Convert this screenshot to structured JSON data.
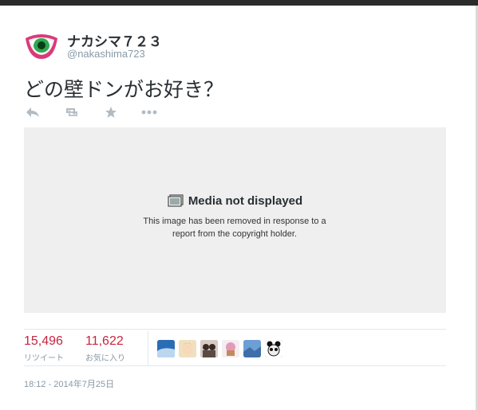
{
  "user": {
    "display_name": "ナカシマ７２３",
    "handle": "@nakashima723",
    "avatar_icon": "green-eye-mouth-avatar"
  },
  "tweet": {
    "text": "どの壁ドンがお好き？"
  },
  "actions": [
    {
      "icon": "reply-icon"
    },
    {
      "icon": "retweet-icon"
    },
    {
      "icon": "favorite-star-icon"
    },
    {
      "icon": "more-icon"
    }
  ],
  "media_notice": {
    "title": "Media not displayed",
    "line1": "This image has been removed in response to a",
    "line2": "report from the copyright holder."
  },
  "stats": {
    "retweets_count": "15,496",
    "retweets_label": "リツイート",
    "favorites_count": "11,622",
    "favorites_label": "お気に入り"
  },
  "favoriters": [
    {
      "icon": "avatar-blue-icon",
      "color": "#2a6db5"
    },
    {
      "icon": "avatar-anime-icon",
      "color": "#e2c796"
    },
    {
      "icon": "avatar-couple-icon",
      "color": "#5b4a44"
    },
    {
      "icon": "avatar-cupcake-icon",
      "color": "#e7c9d6"
    },
    {
      "icon": "avatar-sky-icon",
      "color": "#6d9fd6"
    },
    {
      "icon": "avatar-panda-icon",
      "color": "#2e2e2e"
    }
  ],
  "timestamp": "18:12 - 2014年7月25日",
  "colors": {
    "accent": "#c8243f",
    "muted": "#8899a6",
    "media_bg": "#efefef"
  }
}
